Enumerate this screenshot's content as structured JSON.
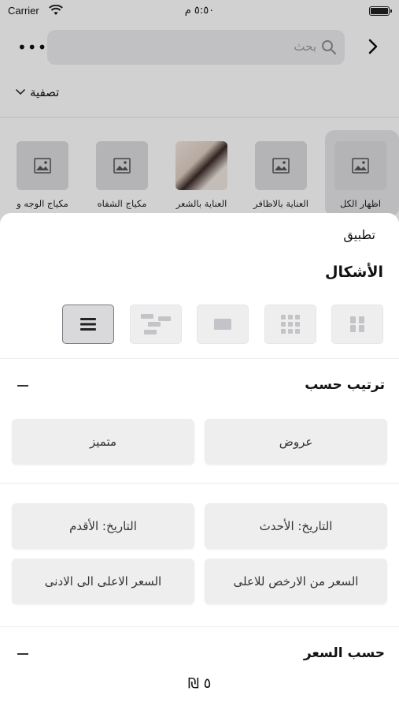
{
  "status_bar": {
    "carrier": "Carrier",
    "time": "٥:٥٠ م"
  },
  "header": {
    "search_placeholder": "بحث",
    "more_label": "•••"
  },
  "filter": {
    "label": "تصفية"
  },
  "categories": [
    {
      "label": "اظهار الكل",
      "image": "image-placeholder-icon",
      "selected": true
    },
    {
      "label": "العناية بالاظافر",
      "image": "image-placeholder-icon"
    },
    {
      "label": "العناية بالشعر",
      "image": "photo"
    },
    {
      "label": "مكياج الشفاه",
      "image": "image-placeholder-icon"
    },
    {
      "label": "مكياج الوجه و",
      "image": "image-placeholder-icon"
    }
  ],
  "sheet": {
    "apply_label": "تطبيق",
    "shapes_title": "الأشكال",
    "layouts": [
      {
        "name": "grid-2-icon",
        "active": false
      },
      {
        "name": "grid-3-icon",
        "active": false
      },
      {
        "name": "single-card-icon",
        "active": false
      },
      {
        "name": "staggered-icon",
        "active": false
      },
      {
        "name": "list-icon",
        "active": true
      }
    ],
    "sort": {
      "title": "ترتيب حسب",
      "collapse_icon": "minus-icon",
      "options": {
        "offers": "عروض",
        "featured": "متميز",
        "date_newest": "التاريخ: الأحدث",
        "date_oldest": "التاريخ: الأقدم",
        "price_low_high": "السعر من الارخص للاعلى",
        "price_high_low": "السعر الاعلى الى الادنى"
      }
    },
    "price": {
      "title": "حسب السعر",
      "collapse_icon": "minus-icon",
      "value": "٥ ₪"
    }
  },
  "colors": {
    "button_bg": "#eeeeef",
    "overlay": "rgba(0,0,0,0.18)",
    "text": "#111111"
  }
}
